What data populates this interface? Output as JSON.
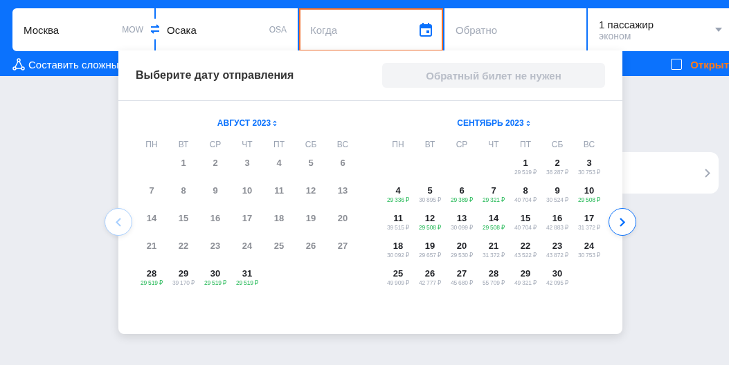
{
  "search": {
    "origin": {
      "city": "Москва",
      "code": "MOW"
    },
    "destination": {
      "city": "Осака",
      "code": "OSA"
    },
    "depart": {
      "placeholder": "Когда",
      "focused": true
    },
    "return": {
      "placeholder": "Обратно"
    },
    "passengers": {
      "count": "1 пассажир",
      "class": "эконом"
    }
  },
  "options": {
    "complex_route": "Составить сложны",
    "checkbox": {
      "checked": false,
      "label": "Открыт"
    }
  },
  "calendar": {
    "title": "Выберите дату отправления",
    "no_return_button": "Обратный билет не нужен",
    "prev": {
      "disabled": true
    },
    "next": {
      "disabled": false
    },
    "months": [
      {
        "title": "АВГУСТ 2023",
        "weekdays": [
          "ПН",
          "ВТ",
          "СР",
          "ЧТ",
          "ПТ",
          "СБ",
          "ВС"
        ],
        "weeks": [
          [
            {
              "kind": "blank"
            },
            {
              "day": "1",
              "disabled": true
            },
            {
              "day": "2",
              "disabled": true
            },
            {
              "day": "3",
              "disabled": true
            },
            {
              "day": "4",
              "disabled": true
            },
            {
              "day": "5",
              "disabled": true
            },
            {
              "day": "6",
              "disabled": true
            }
          ],
          [
            {
              "day": "7",
              "disabled": true
            },
            {
              "day": "8",
              "disabled": true
            },
            {
              "day": "9",
              "disabled": true
            },
            {
              "day": "10",
              "disabled": true
            },
            {
              "day": "11",
              "disabled": true
            },
            {
              "day": "12",
              "disabled": true
            },
            {
              "day": "13",
              "disabled": true
            }
          ],
          [
            {
              "day": "14",
              "disabled": true
            },
            {
              "day": "15",
              "disabled": true
            },
            {
              "day": "16",
              "disabled": true
            },
            {
              "day": "17",
              "disabled": true
            },
            {
              "day": "18",
              "disabled": true
            },
            {
              "day": "19",
              "disabled": true
            },
            {
              "day": "20",
              "disabled": true
            }
          ],
          [
            {
              "day": "21",
              "disabled": true
            },
            {
              "day": "22",
              "disabled": true
            },
            {
              "day": "23",
              "disabled": true
            },
            {
              "day": "24",
              "disabled": true
            },
            {
              "day": "25",
              "disabled": true
            },
            {
              "day": "26",
              "disabled": true
            },
            {
              "day": "27",
              "disabled": true
            }
          ],
          [
            {
              "day": "28",
              "disabled": false,
              "price": "29 519 ₽",
              "cheap": true
            },
            {
              "day": "29",
              "disabled": false,
              "price": "39 170 ₽",
              "cheap": false
            },
            {
              "day": "30",
              "disabled": false,
              "price": "29 519 ₽",
              "cheap": true
            },
            {
              "day": "31",
              "disabled": false,
              "price": "29 519 ₽",
              "cheap": true
            }
          ]
        ]
      },
      {
        "title": "СЕНТЯБРЬ 2023",
        "weekdays": [
          "ПН",
          "ВТ",
          "СР",
          "ЧТ",
          "ПТ",
          "СБ",
          "ВС"
        ],
        "weeks": [
          [
            {
              "kind": "blank"
            },
            {
              "kind": "blank"
            },
            {
              "kind": "blank"
            },
            {
              "kind": "blank"
            },
            {
              "day": "1",
              "disabled": false,
              "price": "29 519 ₽",
              "cheap": false
            },
            {
              "day": "2",
              "disabled": false,
              "price": "38 287 ₽",
              "cheap": false
            },
            {
              "day": "3",
              "disabled": false,
              "price": "30 753 ₽",
              "cheap": false
            }
          ],
          [
            {
              "day": "4",
              "disabled": false,
              "price": "29 336 ₽",
              "cheap": true
            },
            {
              "day": "5",
              "disabled": false,
              "price": "30 895 ₽",
              "cheap": false
            },
            {
              "day": "6",
              "disabled": false,
              "price": "29 389 ₽",
              "cheap": true
            },
            {
              "day": "7",
              "disabled": false,
              "price": "29 321 ₽",
              "cheap": true
            },
            {
              "day": "8",
              "disabled": false,
              "price": "40 704 ₽",
              "cheap": false
            },
            {
              "day": "9",
              "disabled": false,
              "price": "30 524 ₽",
              "cheap": false
            },
            {
              "day": "10",
              "disabled": false,
              "price": "29 508 ₽",
              "cheap": true
            }
          ],
          [
            {
              "day": "11",
              "disabled": false,
              "price": "39 515 ₽",
              "cheap": false
            },
            {
              "day": "12",
              "disabled": false,
              "price": "29 508 ₽",
              "cheap": true
            },
            {
              "day": "13",
              "disabled": false,
              "price": "30 099 ₽",
              "cheap": false
            },
            {
              "day": "14",
              "disabled": false,
              "price": "29 508 ₽",
              "cheap": true
            },
            {
              "day": "15",
              "disabled": false,
              "price": "40 704 ₽",
              "cheap": false
            },
            {
              "day": "16",
              "disabled": false,
              "price": "42 883 ₽",
              "cheap": false
            },
            {
              "day": "17",
              "disabled": false,
              "price": "31 372 ₽",
              "cheap": false
            }
          ],
          [
            {
              "day": "18",
              "disabled": false,
              "price": "30 092 ₽",
              "cheap": false
            },
            {
              "day": "19",
              "disabled": false,
              "price": "29 657 ₽",
              "cheap": false
            },
            {
              "day": "20",
              "disabled": false,
              "price": "29 530 ₽",
              "cheap": false
            },
            {
              "day": "21",
              "disabled": false,
              "price": "31 372 ₽",
              "cheap": false
            },
            {
              "day": "22",
              "disabled": false,
              "price": "43 522 ₽",
              "cheap": false
            },
            {
              "day": "23",
              "disabled": false,
              "price": "43 872 ₽",
              "cheap": false
            },
            {
              "day": "24",
              "disabled": false,
              "price": "30 753 ₽",
              "cheap": false
            }
          ],
          [
            {
              "day": "25",
              "disabled": false,
              "price": "49 909 ₽",
              "cheap": false
            },
            {
              "day": "26",
              "disabled": false,
              "price": "42 777 ₽",
              "cheap": false
            },
            {
              "day": "27",
              "disabled": false,
              "price": "45 680 ₽",
              "cheap": false
            },
            {
              "day": "28",
              "disabled": false,
              "price": "55 709 ₽",
              "cheap": false
            },
            {
              "day": "29",
              "disabled": false,
              "price": "49 321 ₽",
              "cheap": false
            },
            {
              "day": "30",
              "disabled": false,
              "price": "42 095 ₽",
              "cheap": false
            }
          ]
        ]
      }
    ]
  }
}
